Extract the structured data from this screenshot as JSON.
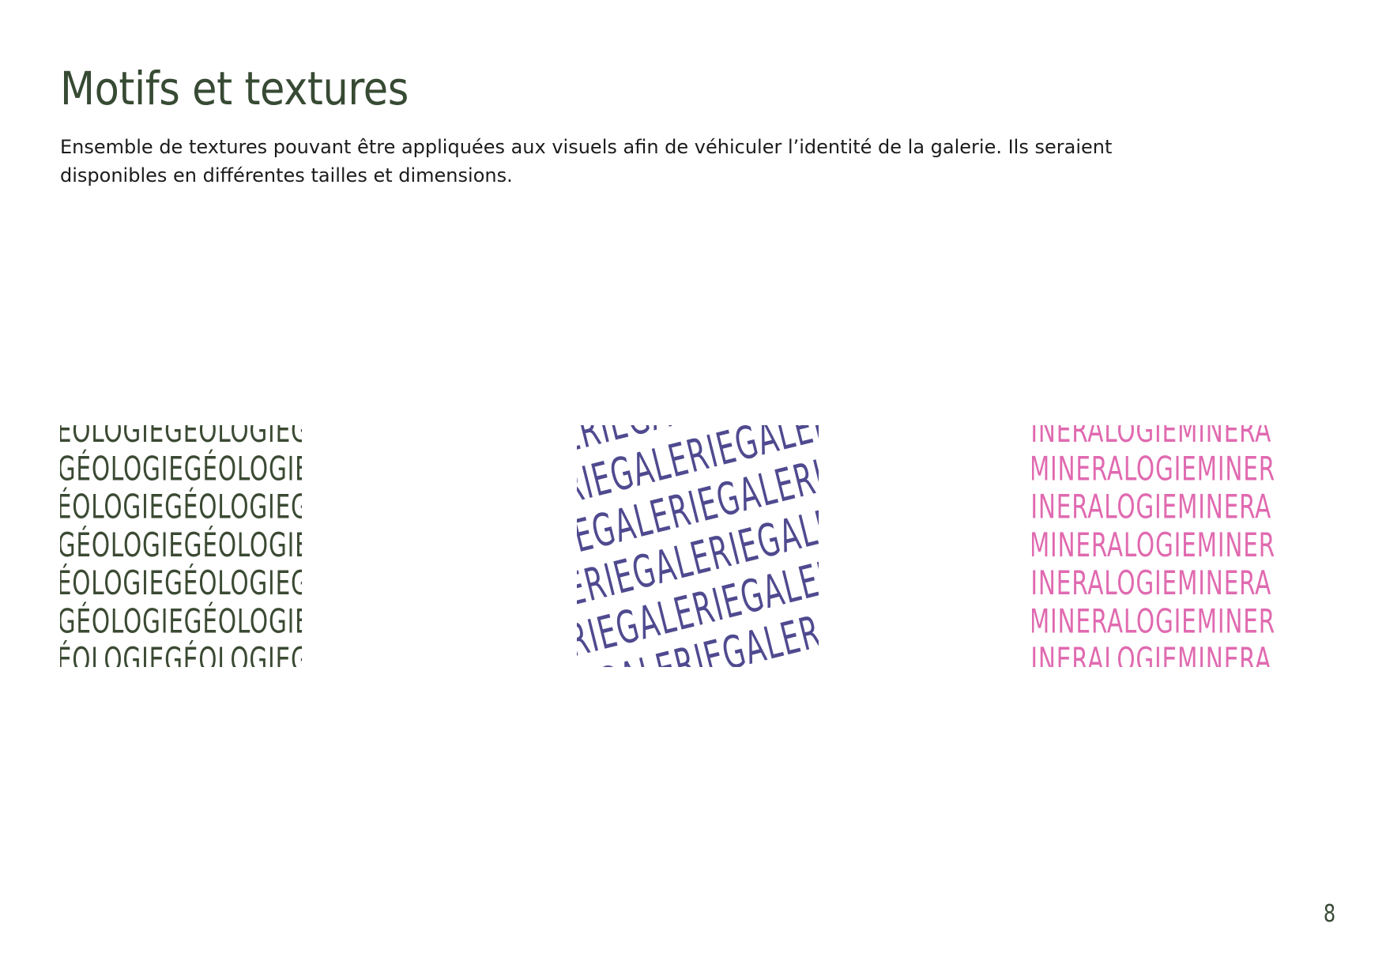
{
  "page": {
    "title": "Motifs et textures",
    "intro": "Ensemble de textures pouvant être appliquées aux visuels afin de véhiculer l’identité de la galerie. Ils seraient disponibles en différentes tailles et dimensions.",
    "page_number": "8"
  },
  "colors": {
    "title": "#374a33",
    "body_text": "#1b1b1b",
    "background": "#ffffff"
  },
  "textures": [
    {
      "name": "geologie",
      "repeat_word": "GÉOLOGIE",
      "color": "#3b4a33",
      "style": "staggered-rows"
    },
    {
      "name": "galerie",
      "repeat_word": "GALERIE",
      "color": "#4f4a8f",
      "style": "wavy-rotated-rows"
    },
    {
      "name": "mineralogie",
      "repeat_word": "MINERALOGIE",
      "color": "#e06ab0",
      "style": "staggered-rows"
    }
  ]
}
